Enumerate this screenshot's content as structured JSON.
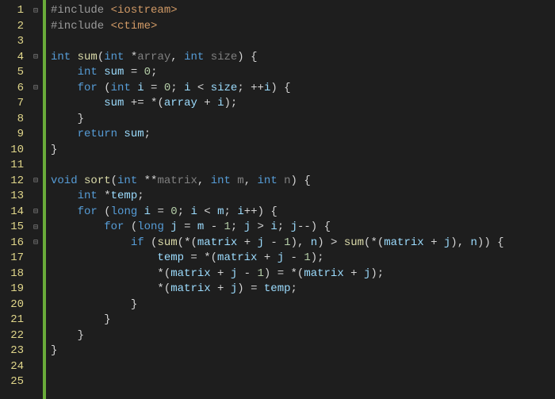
{
  "line_count": 25,
  "fold_markers": {
    "1": "⊟",
    "4": "⊟",
    "6": "⊟",
    "12": "⊟",
    "14": "⊟",
    "15": "⊟",
    "16": "⊟"
  },
  "code": {
    "l1": [
      [
        "pp",
        "#include "
      ],
      [
        "inc",
        "<iostream>"
      ]
    ],
    "l2": [
      [
        "pp",
        "#include "
      ],
      [
        "inc",
        "<ctime>"
      ]
    ],
    "l3": [
      [
        "",
        ""
      ]
    ],
    "l4": [
      [
        "type",
        "int "
      ],
      [
        "fn",
        "sum"
      ],
      [
        "punc",
        "("
      ],
      [
        "type",
        "int "
      ],
      [
        "op",
        "*"
      ],
      [
        "par",
        "array"
      ],
      [
        "punc",
        ", "
      ],
      [
        "type",
        "int "
      ],
      [
        "par",
        "size"
      ],
      [
        "punc",
        ") "
      ],
      [
        "brace",
        "{"
      ]
    ],
    "l5": [
      [
        "",
        "    "
      ],
      [
        "type",
        "int "
      ],
      [
        "id",
        "sum"
      ],
      [
        "op",
        " = "
      ],
      [
        "num",
        "0"
      ],
      [
        "punc",
        ";"
      ]
    ],
    "l6": [
      [
        "",
        "    "
      ],
      [
        "kw",
        "for"
      ],
      [
        "punc",
        " ("
      ],
      [
        "type",
        "int "
      ],
      [
        "id",
        "i"
      ],
      [
        "op",
        " = "
      ],
      [
        "num",
        "0"
      ],
      [
        "punc",
        "; "
      ],
      [
        "id",
        "i"
      ],
      [
        "op",
        " < "
      ],
      [
        "id",
        "size"
      ],
      [
        "punc",
        "; "
      ],
      [
        "op",
        "++"
      ],
      [
        "id",
        "i"
      ],
      [
        "punc",
        ") "
      ],
      [
        "brace",
        "{"
      ]
    ],
    "l7": [
      [
        "",
        "        "
      ],
      [
        "id",
        "sum"
      ],
      [
        "op",
        " += *"
      ],
      [
        "punc",
        "("
      ],
      [
        "id",
        "array"
      ],
      [
        "op",
        " + "
      ],
      [
        "id",
        "i"
      ],
      [
        "punc",
        ");"
      ]
    ],
    "l8": [
      [
        "",
        "    "
      ],
      [
        "brace",
        "}"
      ]
    ],
    "l9": [
      [
        "",
        "    "
      ],
      [
        "kw",
        "return "
      ],
      [
        "id",
        "sum"
      ],
      [
        "punc",
        ";"
      ]
    ],
    "l10": [
      [
        "brace",
        "}"
      ]
    ],
    "l11": [
      [
        "",
        ""
      ]
    ],
    "l12": [
      [
        "type",
        "void "
      ],
      [
        "fn",
        "sort"
      ],
      [
        "punc",
        "("
      ],
      [
        "type",
        "int "
      ],
      [
        "op",
        "**"
      ],
      [
        "par",
        "matrix"
      ],
      [
        "punc",
        ", "
      ],
      [
        "type",
        "int "
      ],
      [
        "par",
        "m"
      ],
      [
        "punc",
        ", "
      ],
      [
        "type",
        "int "
      ],
      [
        "par",
        "n"
      ],
      [
        "punc",
        ") "
      ],
      [
        "brace",
        "{"
      ]
    ],
    "l13": [
      [
        "",
        "    "
      ],
      [
        "type",
        "int "
      ],
      [
        "op",
        "*"
      ],
      [
        "id",
        "temp"
      ],
      [
        "punc",
        ";"
      ]
    ],
    "l14": [
      [
        "",
        "    "
      ],
      [
        "kw",
        "for"
      ],
      [
        "punc",
        " ("
      ],
      [
        "type",
        "long "
      ],
      [
        "id",
        "i"
      ],
      [
        "op",
        " = "
      ],
      [
        "num",
        "0"
      ],
      [
        "punc",
        "; "
      ],
      [
        "id",
        "i"
      ],
      [
        "op",
        " < "
      ],
      [
        "id",
        "m"
      ],
      [
        "punc",
        "; "
      ],
      [
        "id",
        "i"
      ],
      [
        "op",
        "++"
      ],
      [
        "punc",
        ") "
      ],
      [
        "brace",
        "{"
      ]
    ],
    "l15": [
      [
        "",
        "        "
      ],
      [
        "kw",
        "for"
      ],
      [
        "punc",
        " ("
      ],
      [
        "type",
        "long "
      ],
      [
        "id",
        "j"
      ],
      [
        "op",
        " = "
      ],
      [
        "id",
        "m"
      ],
      [
        "op",
        " - "
      ],
      [
        "num",
        "1"
      ],
      [
        "punc",
        "; "
      ],
      [
        "id",
        "j"
      ],
      [
        "op",
        " > "
      ],
      [
        "id",
        "i"
      ],
      [
        "punc",
        "; "
      ],
      [
        "id",
        "j"
      ],
      [
        "op",
        "--"
      ],
      [
        "punc",
        ") "
      ],
      [
        "brace",
        "{"
      ]
    ],
    "l16": [
      [
        "",
        "            "
      ],
      [
        "kw",
        "if"
      ],
      [
        "punc",
        " ("
      ],
      [
        "fn",
        "sum"
      ],
      [
        "punc",
        "("
      ],
      [
        "op",
        "*"
      ],
      [
        "punc",
        "("
      ],
      [
        "id",
        "matrix"
      ],
      [
        "op",
        " + "
      ],
      [
        "id",
        "j"
      ],
      [
        "op",
        " - "
      ],
      [
        "num",
        "1"
      ],
      [
        "punc",
        "), "
      ],
      [
        "id",
        "n"
      ],
      [
        "punc",
        ")"
      ],
      [
        "op",
        " > "
      ],
      [
        "fn",
        "sum"
      ],
      [
        "punc",
        "("
      ],
      [
        "op",
        "*"
      ],
      [
        "punc",
        "("
      ],
      [
        "id",
        "matrix"
      ],
      [
        "op",
        " + "
      ],
      [
        "id",
        "j"
      ],
      [
        "punc",
        "), "
      ],
      [
        "id",
        "n"
      ],
      [
        "punc",
        ")) "
      ],
      [
        "brace",
        "{"
      ]
    ],
    "l17": [
      [
        "",
        "                "
      ],
      [
        "id",
        "temp"
      ],
      [
        "op",
        " = *"
      ],
      [
        "punc",
        "("
      ],
      [
        "id",
        "matrix"
      ],
      [
        "op",
        " + "
      ],
      [
        "id",
        "j"
      ],
      [
        "op",
        " - "
      ],
      [
        "num",
        "1"
      ],
      [
        "punc",
        ");"
      ]
    ],
    "l18": [
      [
        "",
        "                "
      ],
      [
        "op",
        "*"
      ],
      [
        "punc",
        "("
      ],
      [
        "id",
        "matrix"
      ],
      [
        "op",
        " + "
      ],
      [
        "id",
        "j"
      ],
      [
        "op",
        " - "
      ],
      [
        "num",
        "1"
      ],
      [
        "punc",
        ")"
      ],
      [
        "op",
        " = *"
      ],
      [
        "punc",
        "("
      ],
      [
        "id",
        "matrix"
      ],
      [
        "op",
        " + "
      ],
      [
        "id",
        "j"
      ],
      [
        "punc",
        ");"
      ]
    ],
    "l19": [
      [
        "",
        "                "
      ],
      [
        "op",
        "*"
      ],
      [
        "punc",
        "("
      ],
      [
        "id",
        "matrix"
      ],
      [
        "op",
        " + "
      ],
      [
        "id",
        "j"
      ],
      [
        "punc",
        ")"
      ],
      [
        "op",
        " = "
      ],
      [
        "id",
        "temp"
      ],
      [
        "punc",
        ";"
      ]
    ],
    "l20": [
      [
        "",
        "            "
      ],
      [
        "brace",
        "}"
      ]
    ],
    "l21": [
      [
        "",
        "        "
      ],
      [
        "brace",
        "}"
      ]
    ],
    "l22": [
      [
        "",
        "    "
      ],
      [
        "brace",
        "}"
      ]
    ],
    "l23": [
      [
        "brace",
        "}"
      ]
    ],
    "l24": [
      [
        "",
        ""
      ]
    ],
    "l25": [
      [
        "",
        ""
      ]
    ]
  }
}
